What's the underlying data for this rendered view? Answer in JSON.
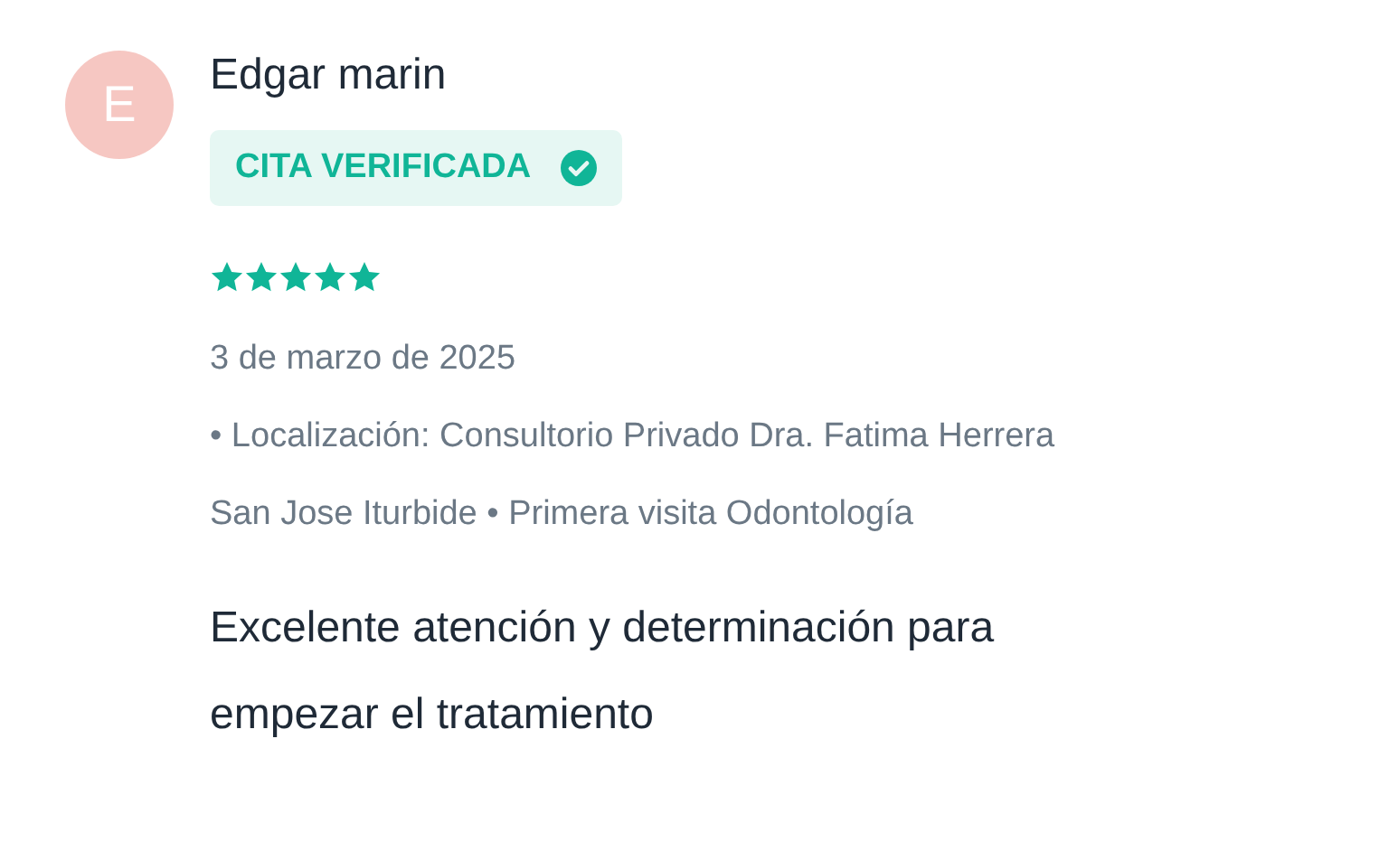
{
  "review": {
    "avatar_initial": "E",
    "author": "Edgar marin",
    "badge": {
      "label": "CITA VERIFICADA",
      "verified": true
    },
    "stars": 5,
    "date": "3 de marzo de 2025",
    "details": [
      "• Localización: Consultorio Privado Dra. Fatima Herrera",
      "San Jose Iturbide • Primera visita Odontología"
    ],
    "text": "Excelente atención y determinación para empezar el tratamiento"
  }
}
